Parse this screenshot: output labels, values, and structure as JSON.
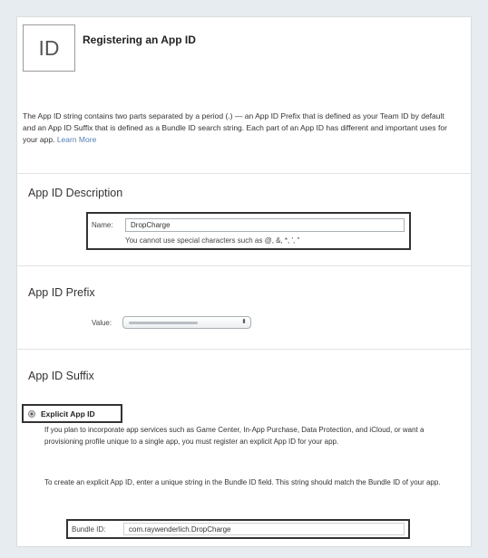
{
  "header": {
    "icon_text": "ID",
    "title": "Registering an App ID"
  },
  "intro": {
    "text": "The App ID string contains two parts separated by a period (.) — an App ID Prefix that is defined as your Team ID by default and an App ID Suffix that is defined as a Bundle ID search string. Each part of an App ID has different and important uses for your app.",
    "learn_more": "Learn More"
  },
  "description": {
    "title": "App ID Description",
    "name_label": "Name:",
    "name_value": "DropCharge",
    "hint": "You cannot use special characters such as @, &, *, ', \""
  },
  "prefix": {
    "title": "App ID Prefix",
    "value_label": "Value:",
    "arrows": "⬍"
  },
  "suffix": {
    "title": "App ID Suffix",
    "explicit_label": "Explicit App ID",
    "para1": "If you plan to incorporate app services such as Game Center, In-App Purchase, Data Protection, and iCloud, or want a provisioning profile unique to a single app, you must register an explicit App ID for your app.",
    "para2": "To create an explicit App ID, enter a unique string in the Bundle ID field. This string should match the Bundle ID of your app.",
    "bundle_label": "Bundle ID:",
    "bundle_value": "com.raywenderlich.DropCharge"
  }
}
